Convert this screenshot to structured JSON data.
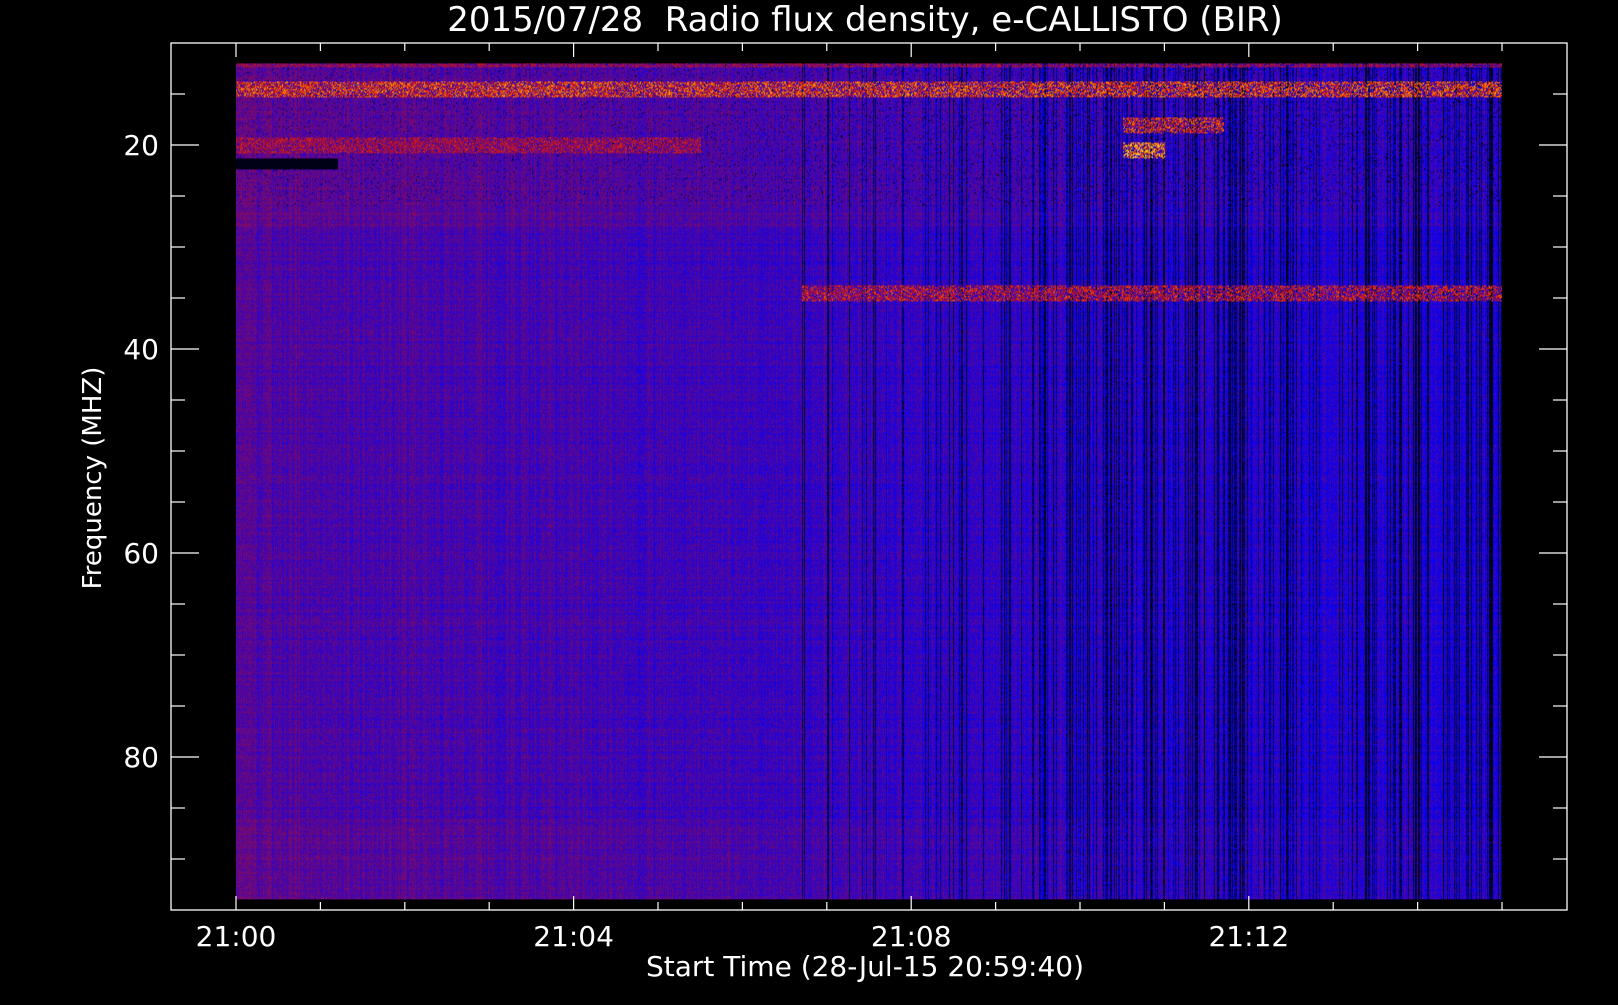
{
  "chart_data": {
    "type": "heatmap",
    "title": "2015/07/28  Radio flux density, e-CALLISTO (BIR)",
    "xlabel": "Start Time (28-Jul-15 20:59:40)",
    "ylabel": "Frequency (MHZ)",
    "x_ticks": [
      "21:00",
      "21:04",
      "21:08",
      "21:12"
    ],
    "y_ticks": [
      "20",
      "40",
      "60",
      "80"
    ],
    "xlim_minutes_after_2100": [
      -0.77,
      15.77
    ],
    "data_x_minutes_after_2100": [
      0,
      15
    ],
    "ylim_mhz": [
      95,
      10
    ],
    "data_y_mhz": [
      12,
      94
    ],
    "colorscale": [
      "#000000",
      "#0000ff",
      "#7a0a6a",
      "#d21414",
      "#ff8c00",
      "#ffff80"
    ],
    "features": [
      {
        "label": "persistent bright band",
        "freq_mhz": 14.5,
        "t_start": 0.0,
        "t_end": 15.0,
        "level": 0.88
      },
      {
        "label": "persistent bright band",
        "freq_mhz": 11.5,
        "t_start": 0.0,
        "t_end": 15.0,
        "level": 0.72
      },
      {
        "label": "bright band",
        "freq_mhz": 20.0,
        "t_start": 0.0,
        "t_end": 5.5,
        "level": 0.75
      },
      {
        "label": "burst",
        "freq_mhz": 18.0,
        "t_start": 10.5,
        "t_end": 11.7,
        "level": 0.85
      },
      {
        "label": "burst",
        "freq_mhz": 20.5,
        "t_start": 10.5,
        "t_end": 11.0,
        "level": 0.97
      },
      {
        "label": "narrowband line",
        "freq_mhz": 34.5,
        "t_start": 6.7,
        "t_end": 15.0,
        "level": 0.8
      },
      {
        "label": "dark band",
        "freq_mhz": 21.8,
        "t_start": 0.0,
        "t_end": 1.2,
        "level": 0.0
      }
    ],
    "grid": false,
    "legend": "none"
  }
}
